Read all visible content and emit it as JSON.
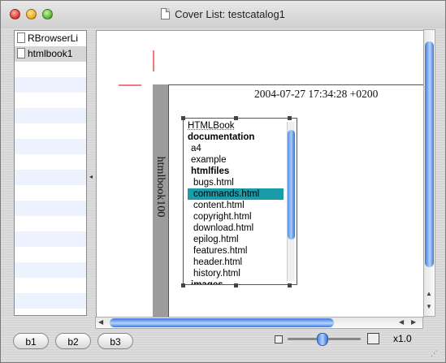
{
  "window": {
    "title": "Cover List: testcatalog1"
  },
  "sidebar": {
    "items": [
      {
        "label": "RBrowserLi",
        "selected": false
      },
      {
        "label": "htmlbook1",
        "selected": true
      }
    ]
  },
  "canvas": {
    "timestamp": "2004-07-27 17:34:28 +0200",
    "spine_title": "htmlbook100",
    "textbox_lines": [
      {
        "text": "HTMLBook",
        "style": "underline"
      },
      {
        "text": "documentation",
        "style": "bold"
      },
      {
        "text": "a4",
        "style": "indent1"
      },
      {
        "text": "example",
        "style": "indent1"
      },
      {
        "text": "htmlfiles",
        "style": "bold-indent1"
      },
      {
        "text": "bugs.html",
        "style": "indent2"
      },
      {
        "text": "commands.html",
        "style": "selected"
      },
      {
        "text": "content.html",
        "style": "indent2"
      },
      {
        "text": "copyright.html",
        "style": "indent2"
      },
      {
        "text": "download.html",
        "style": "indent2"
      },
      {
        "text": "epilog.html",
        "style": "indent2"
      },
      {
        "text": "features.html",
        "style": "indent2"
      },
      {
        "text": "header.html",
        "style": "indent2"
      },
      {
        "text": "history.html",
        "style": "indent2"
      },
      {
        "text": "images",
        "style": "bold-indent1"
      }
    ]
  },
  "toolbar": {
    "b1_label": "b1",
    "b2_label": "b2",
    "b3_label": "b3",
    "zoom_label": "x1.0",
    "zoom_value": 1.0
  },
  "colors": {
    "selection": "#1a9caa",
    "crop_mark": "#f07a7a",
    "scroll_thumb": "#3f77d8"
  }
}
